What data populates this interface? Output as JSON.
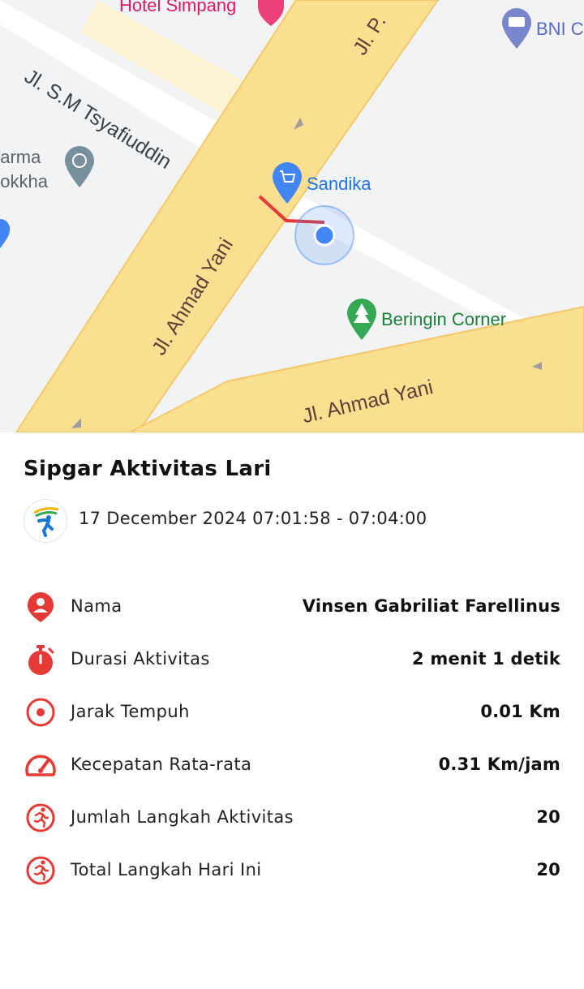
{
  "map": {
    "labels": {
      "hotel": "Hotel Simpang",
      "bni": "BNI C",
      "tsyafiuddin": "Jl. S.M Tsyafiuddin",
      "jl_p": "Jl. P.",
      "dharma": "harma",
      "mokkha": "hokkha",
      "sandika": "Sandika",
      "ahmad_yani_vertical": "Jl. Ahmad Yani",
      "beringin": "Beringin Corner",
      "ahmad_yani_horizontal": "Jl. Ahmad Yani"
    },
    "icons": [
      "hotel-pin-icon",
      "bank-pin-icon",
      "temple-pin-icon",
      "shopping-pin-icon",
      "park-pin-icon",
      "current-location-icon"
    ],
    "colors": {
      "road": "#fbdf90",
      "road_edge": "#f3c86b",
      "background": "#f1f3f4",
      "route": "#e53935",
      "location": "#4285f4",
      "label_blue": "#1a73e8",
      "label_green": "#188038",
      "label_pink": "#d81b60"
    }
  },
  "activity": {
    "title": "Sipgar Aktivitas Lari",
    "datetime": "17 December 2024 07:01:58 - 07:04:00",
    "accent_color": "#e53935",
    "stats": [
      {
        "icon": "person-icon",
        "label": "Nama",
        "value": "Vinsen Gabriliat Farellinus"
      },
      {
        "icon": "stopwatch-icon",
        "label": "Durasi Aktivitas",
        "value": "2 menit 1 detik"
      },
      {
        "icon": "target-icon",
        "label": "Jarak Tempuh",
        "value": "0.01 Km"
      },
      {
        "icon": "speedometer-icon",
        "label": "Kecepatan Rata-rata",
        "value": "0.31 Km/jam"
      },
      {
        "icon": "runner-icon",
        "label": "Jumlah Langkah Aktivitas",
        "value": "20"
      },
      {
        "icon": "runner-icon",
        "label": "Total Langkah Hari Ini",
        "value": "20"
      }
    ]
  }
}
